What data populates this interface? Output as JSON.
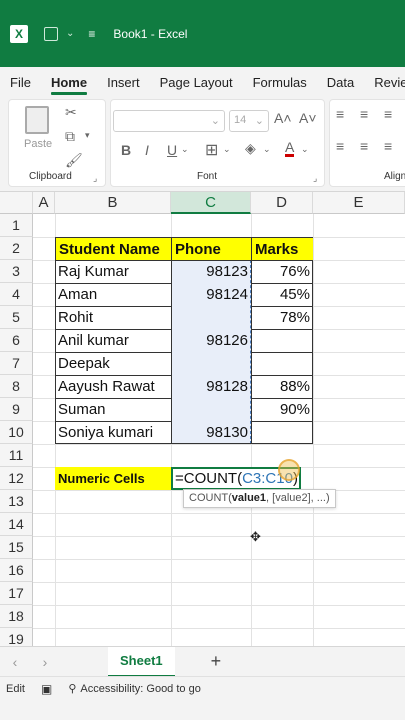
{
  "titlebar": {
    "logo": "X",
    "title": "Book1  -  Excel"
  },
  "menu": [
    "File",
    "Home",
    "Insert",
    "Page Layout",
    "Formulas",
    "Data",
    "Review"
  ],
  "ribbon": {
    "clipboard_label": "Clipboard",
    "paste_label": "Paste",
    "font_label": "Font",
    "font_size": "14",
    "align_label": "Align"
  },
  "columns": [
    "A",
    "B",
    "C",
    "D",
    "E"
  ],
  "rows": [
    "1",
    "2",
    "3",
    "4",
    "5",
    "6",
    "7",
    "8",
    "9",
    "10",
    "11",
    "12",
    "13",
    "14",
    "15",
    "16",
    "17",
    "18",
    "19"
  ],
  "table": {
    "headers": [
      "Student Name",
      "Phone",
      "Marks"
    ],
    "rows": [
      [
        "Raj Kumar",
        "98123",
        "76%"
      ],
      [
        "Aman",
        "98124",
        "45%"
      ],
      [
        "Rohit",
        "",
        "78%"
      ],
      [
        "Anil kumar",
        "98126",
        ""
      ],
      [
        "Deepak",
        "",
        ""
      ],
      [
        "Aayush Rawat",
        "98128",
        "88%"
      ],
      [
        "Suman",
        "",
        "90%"
      ],
      [
        "Soniya kumari",
        "98130",
        ""
      ]
    ]
  },
  "formula_row": {
    "label": "Numeric Cells",
    "formula_prefix": "=COUNT(",
    "formula_ref": "C3:C10",
    "formula_suffix": ")"
  },
  "tooltip": {
    "fn": "COUNT(",
    "arg1": "value1",
    "rest": ", [value2], ...)"
  },
  "sheet_tab": "Sheet1",
  "status": {
    "mode": "Edit",
    "accessibility": "Accessibility: Good to go"
  },
  "colors": {
    "accent": "#107c41",
    "header_fill": "#ffff00",
    "ref_blue": "#2e75b6"
  }
}
